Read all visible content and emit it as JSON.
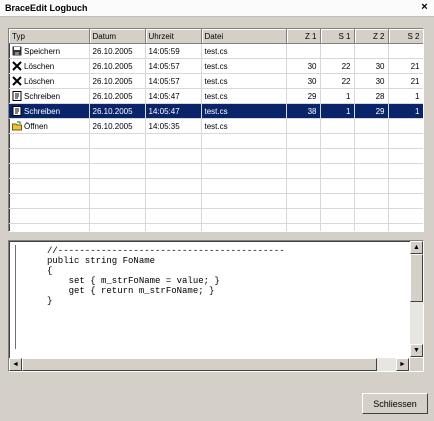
{
  "window": {
    "title": "BraceEdit Logbuch",
    "close_glyph": "×"
  },
  "table": {
    "columns": [
      "Typ",
      "Datum",
      "Uhrzeit",
      "Datei",
      "Z 1",
      "S 1",
      "Z 2",
      "S 2"
    ],
    "rows": [
      {
        "icon": "save-icon",
        "typ": "Speichern",
        "datum": "26.10.2005",
        "uhrzeit": "14:05:59",
        "datei": "test.cs",
        "z1": "",
        "s1": "",
        "z2": "",
        "s2": "",
        "selected": false
      },
      {
        "icon": "delete-icon",
        "typ": "Löschen",
        "datum": "26.10.2005",
        "uhrzeit": "14:05:57",
        "datei": "test.cs",
        "z1": "30",
        "s1": "22",
        "z2": "30",
        "s2": "21",
        "selected": false
      },
      {
        "icon": "delete-icon",
        "typ": "Löschen",
        "datum": "26.10.2005",
        "uhrzeit": "14:05:57",
        "datei": "test.cs",
        "z1": "30",
        "s1": "22",
        "z2": "30",
        "s2": "21",
        "selected": false
      },
      {
        "icon": "write-icon",
        "typ": "Schreiben",
        "datum": "26.10.2005",
        "uhrzeit": "14:05:47",
        "datei": "test.cs",
        "z1": "29",
        "s1": "1",
        "z2": "28",
        "s2": "1",
        "selected": false
      },
      {
        "icon": "write-icon",
        "typ": "Schreiben",
        "datum": "26.10.2005",
        "uhrzeit": "14:05:47",
        "datei": "test.cs",
        "z1": "38",
        "s1": "1",
        "z2": "29",
        "s2": "1",
        "selected": true
      },
      {
        "icon": "open-icon",
        "typ": "Öffnen",
        "datum": "26.10.2005",
        "uhrzeit": "14:05:35",
        "datei": "test.cs",
        "z1": "",
        "s1": "",
        "z2": "",
        "s2": "",
        "selected": false
      }
    ],
    "empty_row_count": 7
  },
  "code": {
    "lines": [
      "//------------------------------------------",
      "public string FoName",
      "{",
      "    set { m_strFoName = value; }",
      "    get { return m_strFoName; }",
      "}"
    ]
  },
  "buttons": {
    "close_label": "Schliessen"
  },
  "colors": {
    "selection": "#0a246a",
    "face": "#d4d0c8"
  }
}
